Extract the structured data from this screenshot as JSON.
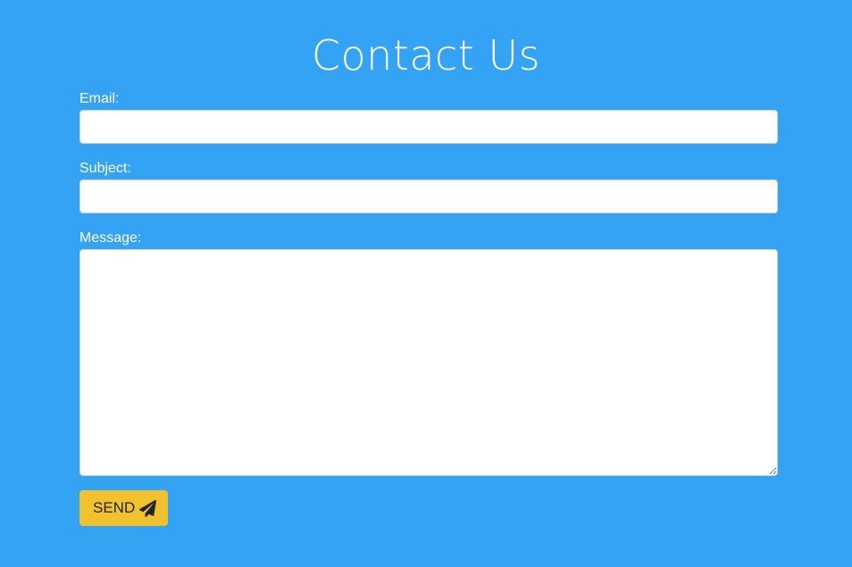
{
  "header": {
    "title": "Contact Us"
  },
  "form": {
    "email": {
      "label": "Email:",
      "value": "",
      "placeholder": ""
    },
    "subject": {
      "label": "Subject:",
      "value": "",
      "placeholder": ""
    },
    "message": {
      "label": "Message:",
      "value": "",
      "placeholder": ""
    },
    "send_button": {
      "label": "SEND",
      "icon": "paper-plane-icon"
    }
  },
  "colors": {
    "background": "#35a3f3",
    "button": "#f2c12e",
    "field": "#ffffff"
  }
}
